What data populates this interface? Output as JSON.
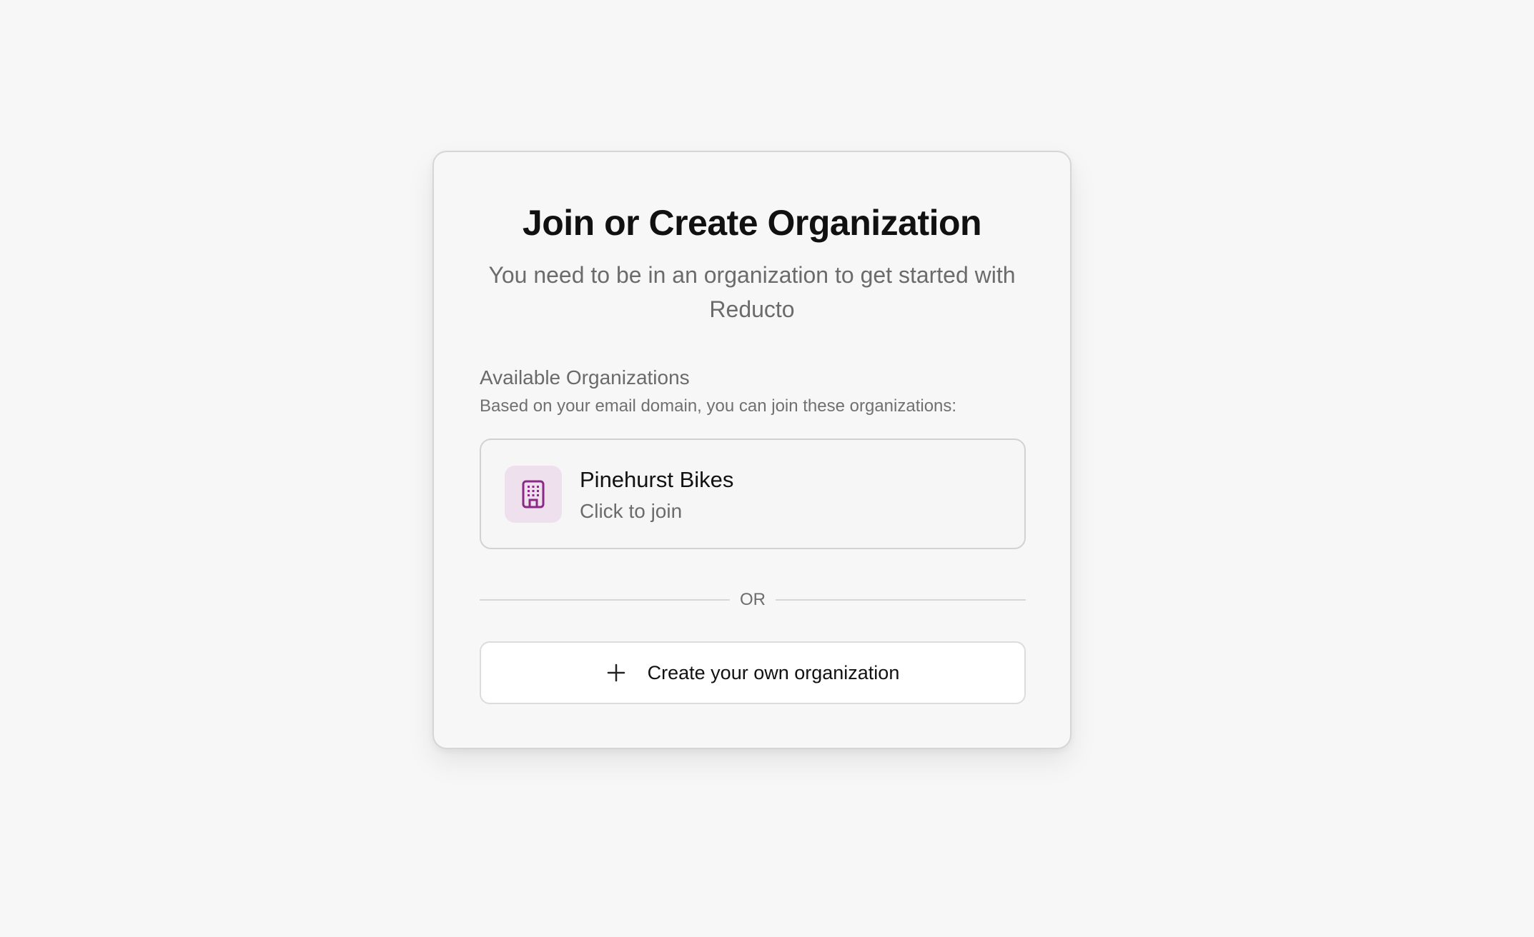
{
  "page": {
    "title": "Join or Create Organization",
    "subtitle": "You need to be in an organization to get started with Reducto"
  },
  "available": {
    "heading": "Available Organizations",
    "description": "Based on your email domain, you can join these organizations:"
  },
  "organizations": [
    {
      "name": "Pinehurst Bikes",
      "action": "Click to join",
      "icon": "building-icon"
    }
  ],
  "divider": {
    "label": "OR"
  },
  "create": {
    "label": "Create your own organization",
    "icon": "plus-icon"
  },
  "colors": {
    "accent": "#8a2a86",
    "icon_background": "#efe0ee",
    "page_background": "#f7f7f7"
  }
}
